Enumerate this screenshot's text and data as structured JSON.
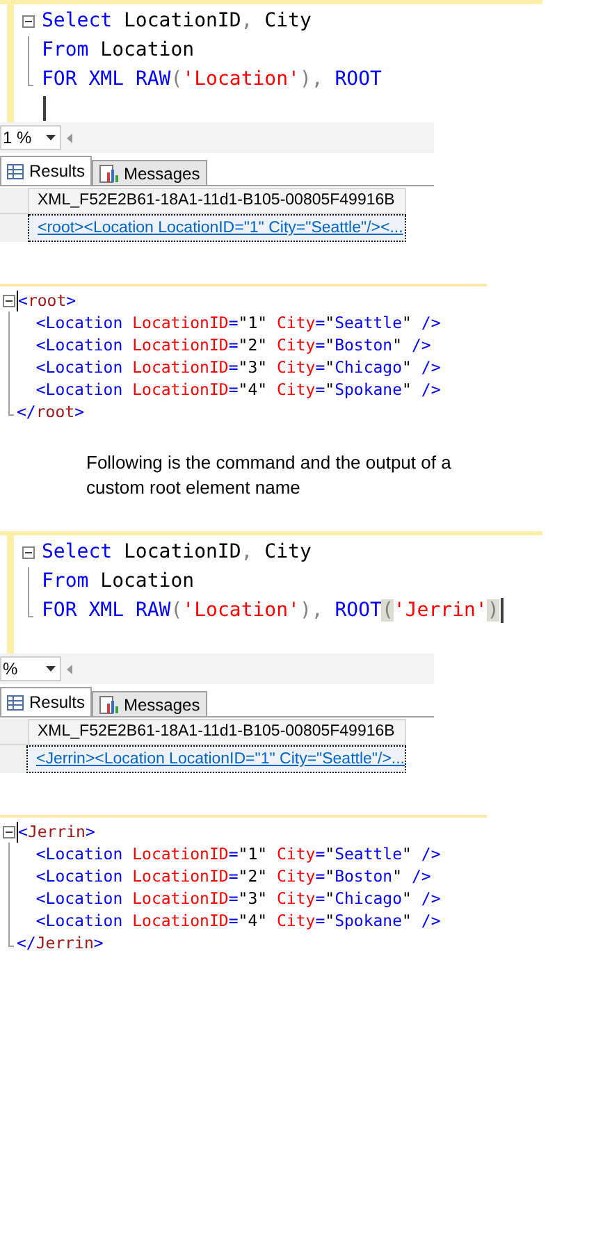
{
  "sections": [
    {
      "kind": "query",
      "lines": [
        {
          "caret": false,
          "tokens": [
            {
              "kind": "keyword",
              "text": "Select"
            },
            {
              "kind": "plain",
              "text": " LocationID"
            },
            {
              "kind": "punct",
              "text": ","
            },
            {
              "kind": "plain",
              "text": " City"
            }
          ]
        },
        {
          "caret": false,
          "tokens": [
            {
              "kind": "keyword",
              "text": "From"
            },
            {
              "kind": "plain",
              "text": " Location"
            }
          ]
        },
        {
          "caret": false,
          "tokens": [
            {
              "kind": "keyword",
              "text": "FOR"
            },
            {
              "kind": "keyword",
              "text": " XML"
            },
            {
              "kind": "keyword",
              "text": " RAW"
            },
            {
              "kind": "punct",
              "text": "("
            },
            {
              "kind": "string",
              "text": "'Location'"
            },
            {
              "kind": "punct",
              "text": "),"
            },
            {
              "kind": "keyword",
              "text": " ROOT"
            }
          ]
        },
        {
          "caret": true
        }
      ],
      "zoom": "1 %",
      "tabs": [
        {
          "label": "Results",
          "selected": true
        },
        {
          "label": "Messages",
          "selected": false
        }
      ],
      "result": {
        "column": "XML_F52E2B61-18A1-11d1-B105-00805F49916B",
        "cell": "<root><Location LocationID=\"1\" City=\"Seattle\"/><..."
      }
    },
    {
      "kind": "xml",
      "lines": [
        {
          "caret": true,
          "tokens": [
            {
              "kind": "delim",
              "text": "<"
            },
            {
              "kind": "element",
              "text": "root"
            },
            {
              "kind": "delim",
              "text": ">"
            }
          ]
        },
        {
          "caret": false,
          "tokens": [
            {
              "kind": "delim",
              "text": "  <Location"
            },
            {
              "kind": "attr",
              "text": " LocationID"
            },
            {
              "kind": "delim",
              "text": "="
            },
            {
              "kind": "quote",
              "text": "\"1\""
            },
            {
              "kind": "attr",
              "text": " City"
            },
            {
              "kind": "delim",
              "text": "="
            },
            {
              "kind": "quote",
              "text": "\""
            },
            {
              "kind": "value",
              "text": "Seattle"
            },
            {
              "kind": "quote",
              "text": "\""
            },
            {
              "kind": "delim",
              "text": " />"
            }
          ]
        },
        {
          "caret": false,
          "tokens": [
            {
              "kind": "delim",
              "text": "  <Location"
            },
            {
              "kind": "attr",
              "text": " LocationID"
            },
            {
              "kind": "delim",
              "text": "="
            },
            {
              "kind": "quote",
              "text": "\"2\""
            },
            {
              "kind": "attr",
              "text": " City"
            },
            {
              "kind": "delim",
              "text": "="
            },
            {
              "kind": "quote",
              "text": "\""
            },
            {
              "kind": "value",
              "text": "Boston"
            },
            {
              "kind": "quote",
              "text": "\""
            },
            {
              "kind": "delim",
              "text": " />"
            }
          ]
        },
        {
          "caret": false,
          "tokens": [
            {
              "kind": "delim",
              "text": "  <Location"
            },
            {
              "kind": "attr",
              "text": " LocationID"
            },
            {
              "kind": "delim",
              "text": "="
            },
            {
              "kind": "quote",
              "text": "\"3\""
            },
            {
              "kind": "attr",
              "text": " City"
            },
            {
              "kind": "delim",
              "text": "="
            },
            {
              "kind": "quote",
              "text": "\""
            },
            {
              "kind": "value",
              "text": "Chicago"
            },
            {
              "kind": "quote",
              "text": "\""
            },
            {
              "kind": "delim",
              "text": " />"
            }
          ]
        },
        {
          "caret": false,
          "tokens": [
            {
              "kind": "delim",
              "text": "  <Location"
            },
            {
              "kind": "attr",
              "text": " LocationID"
            },
            {
              "kind": "delim",
              "text": "="
            },
            {
              "kind": "quote",
              "text": "\"4\""
            },
            {
              "kind": "attr",
              "text": " City"
            },
            {
              "kind": "delim",
              "text": "="
            },
            {
              "kind": "quote",
              "text": "\""
            },
            {
              "kind": "value",
              "text": "Spokane"
            },
            {
              "kind": "quote",
              "text": "\""
            },
            {
              "kind": "delim",
              "text": " />"
            }
          ]
        },
        {
          "caret": false,
          "tokens": [
            {
              "kind": "delim",
              "text": "</"
            },
            {
              "kind": "element",
              "text": "root"
            },
            {
              "kind": "delim",
              "text": ">"
            }
          ]
        }
      ]
    },
    {
      "kind": "caption",
      "text": "Following is the command and the output of a custom root element name"
    },
    {
      "kind": "query",
      "lines": [
        {
          "caret": false,
          "tokens": [
            {
              "kind": "keyword",
              "text": "Select"
            },
            {
              "kind": "plain",
              "text": " LocationID"
            },
            {
              "kind": "punct",
              "text": ","
            },
            {
              "kind": "plain",
              "text": " City"
            }
          ]
        },
        {
          "caret": false,
          "tokens": [
            {
              "kind": "keyword",
              "text": "From"
            },
            {
              "kind": "plain",
              "text": " Location"
            }
          ]
        },
        {
          "caret": true,
          "tokens": [
            {
              "kind": "keyword",
              "text": "FOR"
            },
            {
              "kind": "keyword",
              "text": " XML"
            },
            {
              "kind": "keyword",
              "text": " RAW"
            },
            {
              "kind": "punct",
              "text": "("
            },
            {
              "kind": "string",
              "text": "'Location'"
            },
            {
              "kind": "punct",
              "text": "),"
            },
            {
              "kind": "keyword",
              "text": " ROOT"
            },
            {
              "kind": "match",
              "text": "("
            },
            {
              "kind": "string",
              "text": "'Jerrin'"
            },
            {
              "kind": "match",
              "text": ")"
            }
          ]
        }
      ],
      "zoom": "%",
      "tabs": [
        {
          "label": "Results",
          "selected": true
        },
        {
          "label": "Messages",
          "selected": false
        }
      ],
      "result": {
        "column": "XML_F52E2B61-18A1-11d1-B105-00805F49916B",
        "cell": "<Jerrin><Location LocationID=\"1\" City=\"Seattle\"/>..."
      }
    },
    {
      "kind": "xml",
      "lines": [
        {
          "caret": true,
          "tokens": [
            {
              "kind": "delim",
              "text": "<"
            },
            {
              "kind": "element",
              "text": "Jerrin"
            },
            {
              "kind": "delim",
              "text": ">"
            }
          ]
        },
        {
          "caret": false,
          "tokens": [
            {
              "kind": "delim",
              "text": "  <Location"
            },
            {
              "kind": "attr",
              "text": " LocationID"
            },
            {
              "kind": "delim",
              "text": "="
            },
            {
              "kind": "quote",
              "text": "\"1\""
            },
            {
              "kind": "attr",
              "text": " City"
            },
            {
              "kind": "delim",
              "text": "="
            },
            {
              "kind": "quote",
              "text": "\""
            },
            {
              "kind": "value",
              "text": "Seattle"
            },
            {
              "kind": "quote",
              "text": "\""
            },
            {
              "kind": "delim",
              "text": " />"
            }
          ]
        },
        {
          "caret": false,
          "tokens": [
            {
              "kind": "delim",
              "text": "  <Location"
            },
            {
              "kind": "attr",
              "text": " LocationID"
            },
            {
              "kind": "delim",
              "text": "="
            },
            {
              "kind": "quote",
              "text": "\"2\""
            },
            {
              "kind": "attr",
              "text": " City"
            },
            {
              "kind": "delim",
              "text": "="
            },
            {
              "kind": "quote",
              "text": "\""
            },
            {
              "kind": "value",
              "text": "Boston"
            },
            {
              "kind": "quote",
              "text": "\""
            },
            {
              "kind": "delim",
              "text": " />"
            }
          ]
        },
        {
          "caret": false,
          "tokens": [
            {
              "kind": "delim",
              "text": "  <Location"
            },
            {
              "kind": "attr",
              "text": " LocationID"
            },
            {
              "kind": "delim",
              "text": "="
            },
            {
              "kind": "quote",
              "text": "\"3\""
            },
            {
              "kind": "attr",
              "text": " City"
            },
            {
              "kind": "delim",
              "text": "="
            },
            {
              "kind": "quote",
              "text": "\""
            },
            {
              "kind": "value",
              "text": "Chicago"
            },
            {
              "kind": "quote",
              "text": "\""
            },
            {
              "kind": "delim",
              "text": " />"
            }
          ]
        },
        {
          "caret": false,
          "tokens": [
            {
              "kind": "delim",
              "text": "  <Location"
            },
            {
              "kind": "attr",
              "text": " LocationID"
            },
            {
              "kind": "delim",
              "text": "="
            },
            {
              "kind": "quote",
              "text": "\"4\""
            },
            {
              "kind": "attr",
              "text": " City"
            },
            {
              "kind": "delim",
              "text": "="
            },
            {
              "kind": "quote",
              "text": "\""
            },
            {
              "kind": "value",
              "text": "Spokane"
            },
            {
              "kind": "quote",
              "text": "\""
            },
            {
              "kind": "delim",
              "text": " />"
            }
          ]
        },
        {
          "caret": false,
          "tokens": [
            {
              "kind": "delim",
              "text": "</"
            },
            {
              "kind": "element",
              "text": "Jerrin"
            },
            {
              "kind": "delim",
              "text": ">"
            }
          ]
        }
      ]
    }
  ]
}
